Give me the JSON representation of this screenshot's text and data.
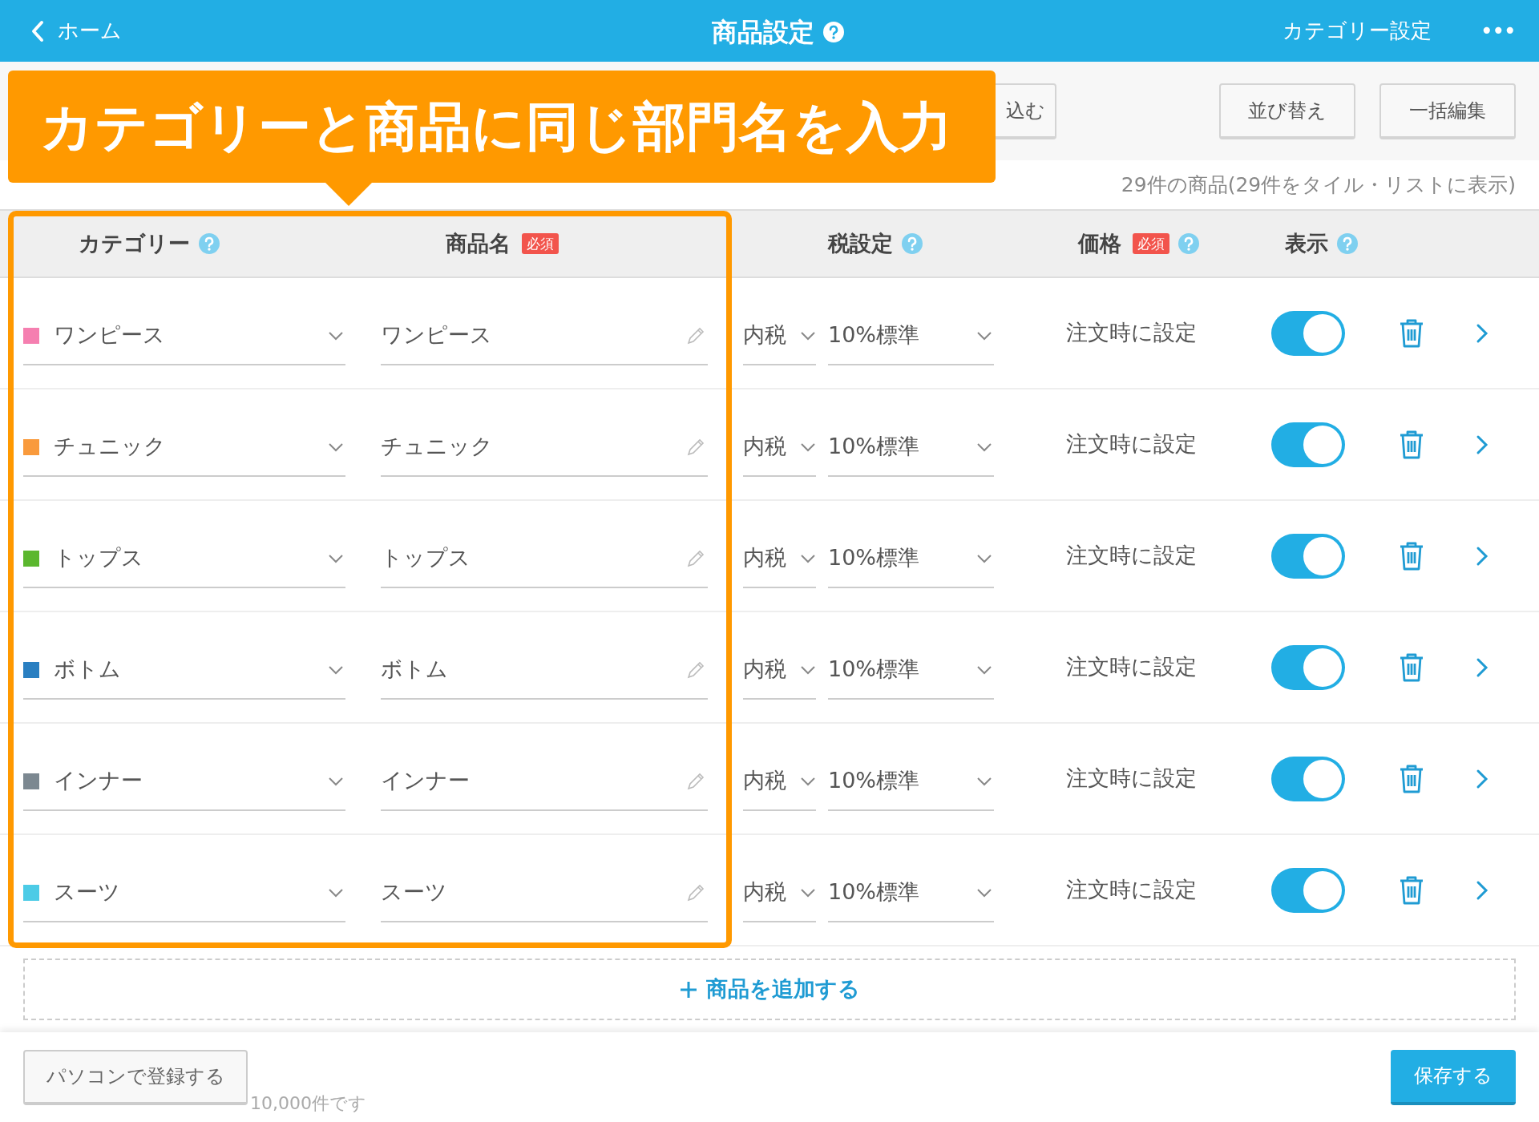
{
  "nav": {
    "back": "ホーム",
    "title": "商品設定",
    "help": true,
    "right_link": "カテゴリー設定",
    "more": "•••"
  },
  "toolbar": {
    "buttons": [
      "込む",
      "並び替え",
      "一括編集"
    ],
    "count": "29件の商品(29件をタイル・リストに表示)"
  },
  "callout": "カテゴリーと商品に同じ部門名を入力",
  "columns": [
    {
      "label": "カテゴリー",
      "help": true
    },
    {
      "label": "商品名",
      "badge": "必須",
      "help": false
    },
    {
      "label": "税設定",
      "help": true
    },
    {
      "label": "価格",
      "badge": "必須",
      "help": true
    },
    {
      "label": "表示",
      "help": true
    }
  ],
  "rows": [
    {
      "category": "ワンピース",
      "color": "#f57fb0",
      "name": "ワンピース",
      "tax": "内税",
      "rate": "10%標準",
      "price": "注文時に設定",
      "visible": true
    },
    {
      "category": "チュニック",
      "color": "#f99a3c",
      "name": "チュニック",
      "tax": "内税",
      "rate": "10%標準",
      "price": "注文時に設定",
      "visible": true
    },
    {
      "category": "トップス",
      "color": "#5bb72e",
      "name": "トップス",
      "tax": "内税",
      "rate": "10%標準",
      "price": "注文時に設定",
      "visible": true
    },
    {
      "category": "ボトム",
      "color": "#2a7fc1",
      "name": "ボトム",
      "tax": "内税",
      "rate": "10%標準",
      "price": "注文時に設定",
      "visible": true
    },
    {
      "category": "インナー",
      "color": "#7c8891",
      "name": "インナー",
      "tax": "内税",
      "rate": "10%標準",
      "price": "注文時に設定",
      "visible": true
    },
    {
      "category": "スーツ",
      "color": "#4ccbe6",
      "name": "スーツ",
      "tax": "内税",
      "rate": "10%標準",
      "price": "注文時に設定",
      "visible": true
    }
  ],
  "add_button": "商品を追加する",
  "footer": {
    "pc_button": "パソコンで登録する",
    "note": "10,000件です",
    "save_button": "保存する"
  }
}
